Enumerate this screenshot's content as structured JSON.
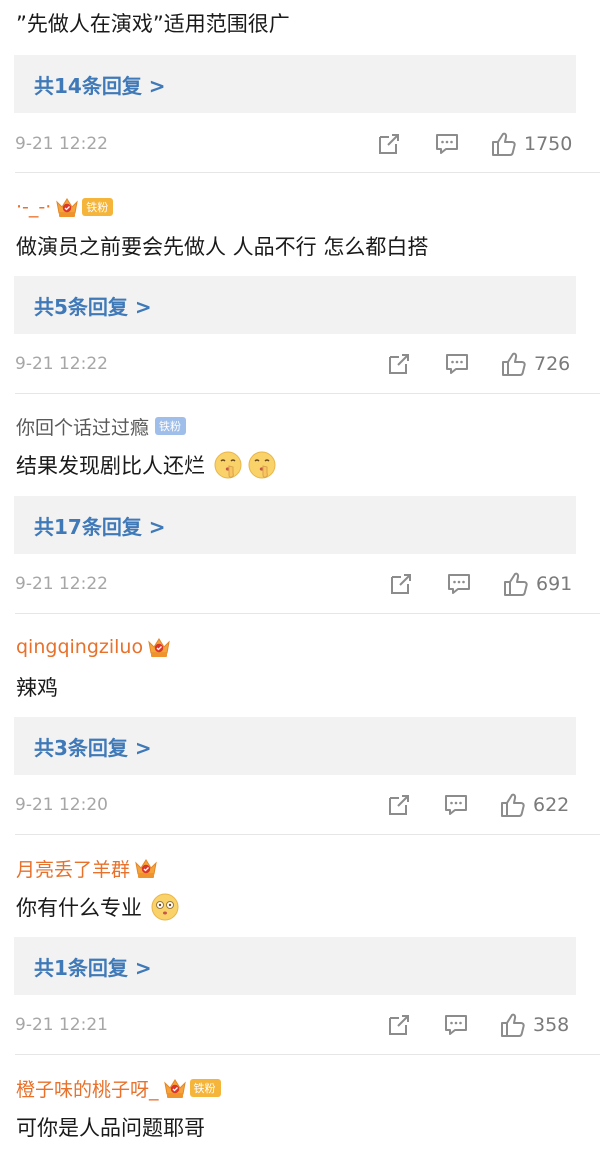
{
  "comments": [
    {
      "text": "”先做人在演戏”适用范围很广",
      "reply_label": "共14条回复 >",
      "time": "9-21 12:22",
      "likes": "1750"
    },
    {
      "author": "·-_-·",
      "author_color": "#e8712b",
      "badge_text": "铁粉",
      "text": "做演员之前要会先做人 人品不行 怎么都白搭",
      "reply_label": "共5条回复 >",
      "time": "9-21 12:22",
      "likes": "726"
    },
    {
      "author": "你回个话过过瘾",
      "author_color": "#5a5a5a",
      "badge_text": "铁粉",
      "text": "结果发现剧比人还烂",
      "reply_label": "共17条回复 >",
      "time": "9-21 12:22",
      "likes": "691"
    },
    {
      "author": "qingqingziluo",
      "author_color": "#e8712b",
      "text": "辣鸡",
      "reply_label": "共3条回复 >",
      "time": "9-21 12:20",
      "likes": "622"
    },
    {
      "author": "月亮丢了羊群",
      "author_color": "#e8712b",
      "text": "你有什么专业",
      "reply_label": "共1条回复 >",
      "time": "9-21 12:21",
      "likes": "358"
    },
    {
      "author": "橙子味的桃子呀_",
      "author_color": "#e8712b",
      "badge_text": "铁粉",
      "text": "可你是人品问题耶哥"
    }
  ],
  "icons": {
    "share": "share-icon",
    "comment": "comment-icon",
    "like": "thumbs-up-icon",
    "emoji_shush": "shush-emoji-icon",
    "emoji_dizzy": "dizzy-emoji-icon",
    "crown": "vip-crown-icon"
  },
  "colors": {
    "reply_link": "#3f79b8",
    "username_vip": "#e8712b",
    "reply_bg": "#f2f2f2",
    "fan_badge": "#f5b53a",
    "fan_badge_blue": "#9fbfea"
  }
}
